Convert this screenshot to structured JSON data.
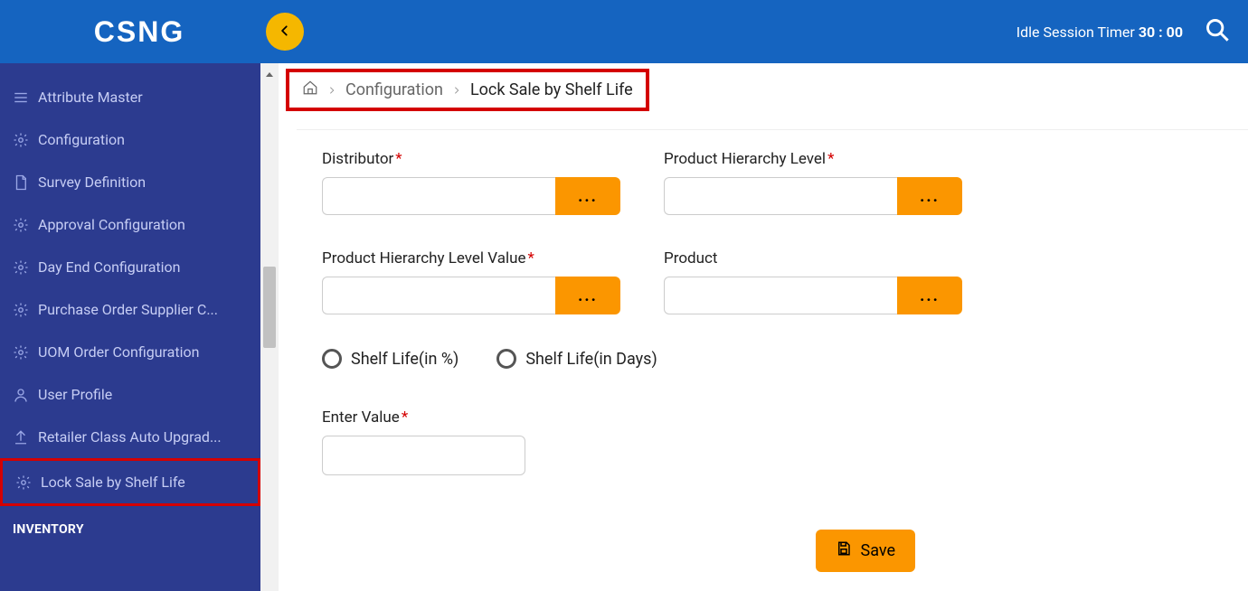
{
  "header": {
    "logo_text": "CSNG",
    "idle_label": "Idle Session Timer",
    "idle_time": "30 : 00"
  },
  "sidebar": {
    "items": [
      {
        "label": "Attribute Master",
        "icon": "list"
      },
      {
        "label": "Configuration",
        "icon": "gear"
      },
      {
        "label": "Survey Definition",
        "icon": "doc"
      },
      {
        "label": "Approval Configuration",
        "icon": "gear"
      },
      {
        "label": "Day End Configuration",
        "icon": "gear"
      },
      {
        "label": "Purchase Order Supplier C...",
        "icon": "gear"
      },
      {
        "label": "UOM Order Configuration",
        "icon": "gear"
      },
      {
        "label": "User Profile",
        "icon": "user"
      },
      {
        "label": "Retailer Class Auto Upgrad...",
        "icon": "upgrade"
      },
      {
        "label": "Lock Sale by Shelf Life",
        "icon": "gear",
        "selected": true
      }
    ],
    "section_header": "INVENTORY"
  },
  "breadcrumb": {
    "level1": "Configuration",
    "level2": "Lock Sale by Shelf Life"
  },
  "form": {
    "distributor_label": "Distributor",
    "product_hierarchy_level_label": "Product Hierarchy Level",
    "product_hierarchy_level_value_label": "Product Hierarchy Level Value",
    "product_label": "Product",
    "lookup_glyph": "...",
    "radio_percent_label": "Shelf Life(in %)",
    "radio_days_label": "Shelf Life(in Days)",
    "enter_value_label": "Enter Value",
    "save_label": "Save"
  }
}
